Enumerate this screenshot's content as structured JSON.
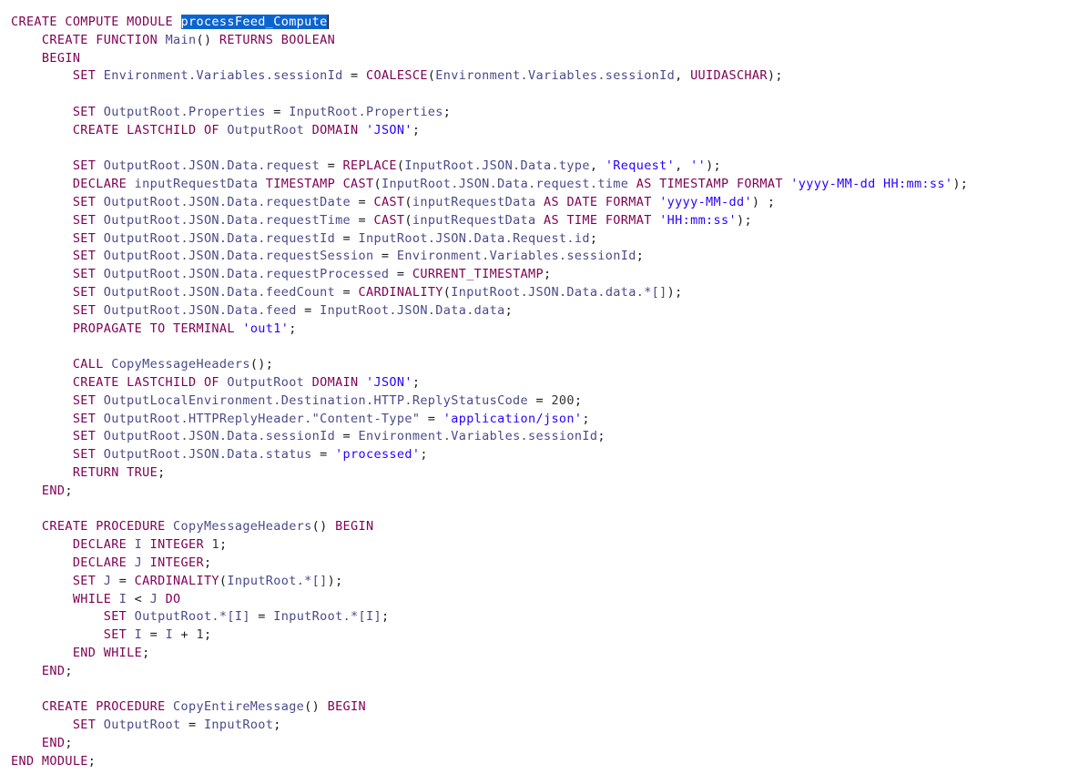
{
  "editor": {
    "selected_text": "processFeed_Compute",
    "lines": [
      [
        {
          "t": "CREATE COMPUTE MODULE ",
          "c": "kw"
        },
        {
          "t": "processFeed_Compute",
          "c": "sel"
        }
      ],
      [
        {
          "t": "    CREATE FUNCTION ",
          "c": "kw"
        },
        {
          "t": "Main",
          "c": "id"
        },
        {
          "t": "() ",
          "c": "sym"
        },
        {
          "t": "RETURNS BOOLEAN",
          "c": "kw"
        }
      ],
      [
        {
          "t": "    BEGIN",
          "c": "kw"
        }
      ],
      [
        {
          "t": "        SET ",
          "c": "kw"
        },
        {
          "t": "Environment.Variables.sessionId",
          "c": "id"
        },
        {
          "t": " = ",
          "c": "sym"
        },
        {
          "t": "COALESCE",
          "c": "kw"
        },
        {
          "t": "(",
          "c": "sym"
        },
        {
          "t": "Environment.Variables.sessionId",
          "c": "id"
        },
        {
          "t": ", ",
          "c": "sym"
        },
        {
          "t": "UUIDASCHAR",
          "c": "kw"
        },
        {
          "t": ");",
          "c": "sym"
        }
      ],
      [],
      [
        {
          "t": "        SET ",
          "c": "kw"
        },
        {
          "t": "OutputRoot.Properties",
          "c": "id"
        },
        {
          "t": " = ",
          "c": "sym"
        },
        {
          "t": "InputRoot.Properties",
          "c": "id"
        },
        {
          "t": ";",
          "c": "sym"
        }
      ],
      [
        {
          "t": "        CREATE LASTCHILD OF ",
          "c": "kw"
        },
        {
          "t": "OutputRoot",
          "c": "id"
        },
        {
          "t": " DOMAIN ",
          "c": "kw"
        },
        {
          "t": "'JSON'",
          "c": "str"
        },
        {
          "t": ";",
          "c": "sym"
        }
      ],
      [],
      [
        {
          "t": "        SET ",
          "c": "kw"
        },
        {
          "t": "OutputRoot.JSON.Data.request",
          "c": "id"
        },
        {
          "t": " = ",
          "c": "sym"
        },
        {
          "t": "REPLACE",
          "c": "kw"
        },
        {
          "t": "(",
          "c": "sym"
        },
        {
          "t": "InputRoot.JSON.Data.type",
          "c": "id"
        },
        {
          "t": ", ",
          "c": "sym"
        },
        {
          "t": "'Request'",
          "c": "str"
        },
        {
          "t": ", ",
          "c": "sym"
        },
        {
          "t": "''",
          "c": "str"
        },
        {
          "t": ");",
          "c": "sym"
        }
      ],
      [
        {
          "t": "        DECLARE ",
          "c": "kw"
        },
        {
          "t": "inputRequestData",
          "c": "id"
        },
        {
          "t": " TIMESTAMP CAST",
          "c": "kw"
        },
        {
          "t": "(",
          "c": "sym"
        },
        {
          "t": "InputRoot.JSON.Data.request.time",
          "c": "id"
        },
        {
          "t": " AS TIMESTAMP FORMAT ",
          "c": "kw"
        },
        {
          "t": "'yyyy-MM-dd HH:mm:ss'",
          "c": "str"
        },
        {
          "t": ");",
          "c": "sym"
        }
      ],
      [
        {
          "t": "        SET ",
          "c": "kw"
        },
        {
          "t": "OutputRoot.JSON.Data.requestDate",
          "c": "id"
        },
        {
          "t": " = ",
          "c": "sym"
        },
        {
          "t": "CAST",
          "c": "kw"
        },
        {
          "t": "(",
          "c": "sym"
        },
        {
          "t": "inputRequestData",
          "c": "id"
        },
        {
          "t": " AS DATE FORMAT ",
          "c": "kw"
        },
        {
          "t": "'yyyy-MM-dd'",
          "c": "str"
        },
        {
          "t": ") ;",
          "c": "sym"
        }
      ],
      [
        {
          "t": "        SET ",
          "c": "kw"
        },
        {
          "t": "OutputRoot.JSON.Data.requestTime",
          "c": "id"
        },
        {
          "t": " = ",
          "c": "sym"
        },
        {
          "t": "CAST",
          "c": "kw"
        },
        {
          "t": "(",
          "c": "sym"
        },
        {
          "t": "inputRequestData",
          "c": "id"
        },
        {
          "t": " AS TIME FORMAT ",
          "c": "kw"
        },
        {
          "t": "'HH:mm:ss'",
          "c": "str"
        },
        {
          "t": ");",
          "c": "sym"
        }
      ],
      [
        {
          "t": "        SET ",
          "c": "kw"
        },
        {
          "t": "OutputRoot.JSON.Data.requestId",
          "c": "id"
        },
        {
          "t": " = ",
          "c": "sym"
        },
        {
          "t": "InputRoot.JSON.Data.Request.id",
          "c": "id"
        },
        {
          "t": ";",
          "c": "sym"
        }
      ],
      [
        {
          "t": "        SET ",
          "c": "kw"
        },
        {
          "t": "OutputRoot.JSON.Data.requestSession",
          "c": "id"
        },
        {
          "t": " = ",
          "c": "sym"
        },
        {
          "t": "Environment.Variables.sessionId",
          "c": "id"
        },
        {
          "t": ";",
          "c": "sym"
        }
      ],
      [
        {
          "t": "        SET ",
          "c": "kw"
        },
        {
          "t": "OutputRoot.JSON.Data.requestProcessed",
          "c": "id"
        },
        {
          "t": " = ",
          "c": "sym"
        },
        {
          "t": "CURRENT_TIMESTAMP",
          "c": "kw"
        },
        {
          "t": ";",
          "c": "sym"
        }
      ],
      [
        {
          "t": "        SET ",
          "c": "kw"
        },
        {
          "t": "OutputRoot.JSON.Data.feedCount",
          "c": "id"
        },
        {
          "t": " = ",
          "c": "sym"
        },
        {
          "t": "CARDINALITY",
          "c": "kw"
        },
        {
          "t": "(",
          "c": "sym"
        },
        {
          "t": "InputRoot.JSON.Data.data.*[]",
          "c": "id"
        },
        {
          "t": ");",
          "c": "sym"
        }
      ],
      [
        {
          "t": "        SET ",
          "c": "kw"
        },
        {
          "t": "OutputRoot.JSON.Data.feed",
          "c": "id"
        },
        {
          "t": " = ",
          "c": "sym"
        },
        {
          "t": "InputRoot.JSON.Data.data",
          "c": "id"
        },
        {
          "t": ";",
          "c": "sym"
        }
      ],
      [
        {
          "t": "        PROPAGATE TO TERMINAL ",
          "c": "kw"
        },
        {
          "t": "'out1'",
          "c": "str"
        },
        {
          "t": ";",
          "c": "sym"
        }
      ],
      [],
      [
        {
          "t": "        CALL ",
          "c": "kw"
        },
        {
          "t": "CopyMessageHeaders",
          "c": "id"
        },
        {
          "t": "();",
          "c": "sym"
        }
      ],
      [
        {
          "t": "        CREATE LASTCHILD OF ",
          "c": "kw"
        },
        {
          "t": "OutputRoot",
          "c": "id"
        },
        {
          "t": " DOMAIN ",
          "c": "kw"
        },
        {
          "t": "'JSON'",
          "c": "str"
        },
        {
          "t": ";",
          "c": "sym"
        }
      ],
      [
        {
          "t": "        SET ",
          "c": "kw"
        },
        {
          "t": "OutputLocalEnvironment.Destination.HTTP.ReplyStatusCode",
          "c": "id"
        },
        {
          "t": " = ",
          "c": "sym"
        },
        {
          "t": "200",
          "c": "num"
        },
        {
          "t": ";",
          "c": "sym"
        }
      ],
      [
        {
          "t": "        SET ",
          "c": "kw"
        },
        {
          "t": "OutputRoot.HTTPReplyHeader.\"Content-Type\"",
          "c": "id"
        },
        {
          "t": " = ",
          "c": "sym"
        },
        {
          "t": "'application/json'",
          "c": "str"
        },
        {
          "t": ";",
          "c": "sym"
        }
      ],
      [
        {
          "t": "        SET ",
          "c": "kw"
        },
        {
          "t": "OutputRoot.JSON.Data.sessionId",
          "c": "id"
        },
        {
          "t": " = ",
          "c": "sym"
        },
        {
          "t": "Environment.Variables.sessionId",
          "c": "id"
        },
        {
          "t": ";",
          "c": "sym"
        }
      ],
      [
        {
          "t": "        SET ",
          "c": "kw"
        },
        {
          "t": "OutputRoot.JSON.Data.status",
          "c": "id"
        },
        {
          "t": " = ",
          "c": "sym"
        },
        {
          "t": "'processed'",
          "c": "str"
        },
        {
          "t": ";",
          "c": "sym"
        }
      ],
      [
        {
          "t": "        RETURN TRUE",
          "c": "kw"
        },
        {
          "t": ";",
          "c": "sym"
        }
      ],
      [
        {
          "t": "    END",
          "c": "kw"
        },
        {
          "t": ";",
          "c": "sym"
        }
      ],
      [],
      [
        {
          "t": "    CREATE PROCEDURE ",
          "c": "kw"
        },
        {
          "t": "CopyMessageHeaders",
          "c": "id"
        },
        {
          "t": "() ",
          "c": "sym"
        },
        {
          "t": "BEGIN",
          "c": "kw"
        }
      ],
      [
        {
          "t": "        DECLARE ",
          "c": "kw"
        },
        {
          "t": "I",
          "c": "id"
        },
        {
          "t": " INTEGER ",
          "c": "kw"
        },
        {
          "t": "1",
          "c": "num"
        },
        {
          "t": ";",
          "c": "sym"
        }
      ],
      [
        {
          "t": "        DECLARE ",
          "c": "kw"
        },
        {
          "t": "J",
          "c": "id"
        },
        {
          "t": " INTEGER",
          "c": "kw"
        },
        {
          "t": ";",
          "c": "sym"
        }
      ],
      [
        {
          "t": "        SET ",
          "c": "kw"
        },
        {
          "t": "J",
          "c": "id"
        },
        {
          "t": " = ",
          "c": "sym"
        },
        {
          "t": "CARDINALITY",
          "c": "kw"
        },
        {
          "t": "(",
          "c": "sym"
        },
        {
          "t": "InputRoot.*[]",
          "c": "id"
        },
        {
          "t": ");",
          "c": "sym"
        }
      ],
      [
        {
          "t": "        WHILE ",
          "c": "kw"
        },
        {
          "t": "I",
          "c": "id"
        },
        {
          "t": " < ",
          "c": "sym"
        },
        {
          "t": "J",
          "c": "id"
        },
        {
          "t": " DO",
          "c": "kw"
        }
      ],
      [
        {
          "t": "            SET ",
          "c": "kw"
        },
        {
          "t": "OutputRoot.*[I]",
          "c": "id"
        },
        {
          "t": " = ",
          "c": "sym"
        },
        {
          "t": "InputRoot.*[I]",
          "c": "id"
        },
        {
          "t": ";",
          "c": "sym"
        }
      ],
      [
        {
          "t": "            SET ",
          "c": "kw"
        },
        {
          "t": "I",
          "c": "id"
        },
        {
          "t": " = ",
          "c": "sym"
        },
        {
          "t": "I",
          "c": "id"
        },
        {
          "t": " + ",
          "c": "sym"
        },
        {
          "t": "1",
          "c": "num"
        },
        {
          "t": ";",
          "c": "sym"
        }
      ],
      [
        {
          "t": "        END WHILE",
          "c": "kw"
        },
        {
          "t": ";",
          "c": "sym"
        }
      ],
      [
        {
          "t": "    END",
          "c": "kw"
        },
        {
          "t": ";",
          "c": "sym"
        }
      ],
      [],
      [
        {
          "t": "    CREATE PROCEDURE ",
          "c": "kw"
        },
        {
          "t": "CopyEntireMessage",
          "c": "id"
        },
        {
          "t": "() ",
          "c": "sym"
        },
        {
          "t": "BEGIN",
          "c": "kw"
        }
      ],
      [
        {
          "t": "        SET ",
          "c": "kw"
        },
        {
          "t": "OutputRoot",
          "c": "id"
        },
        {
          "t": " = ",
          "c": "sym"
        },
        {
          "t": "InputRoot",
          "c": "id"
        },
        {
          "t": ";",
          "c": "sym"
        }
      ],
      [
        {
          "t": "    END",
          "c": "kw"
        },
        {
          "t": ";",
          "c": "sym"
        }
      ],
      [
        {
          "t": "END MODULE",
          "c": "kw"
        },
        {
          "t": ";",
          "c": "sym"
        }
      ]
    ]
  }
}
